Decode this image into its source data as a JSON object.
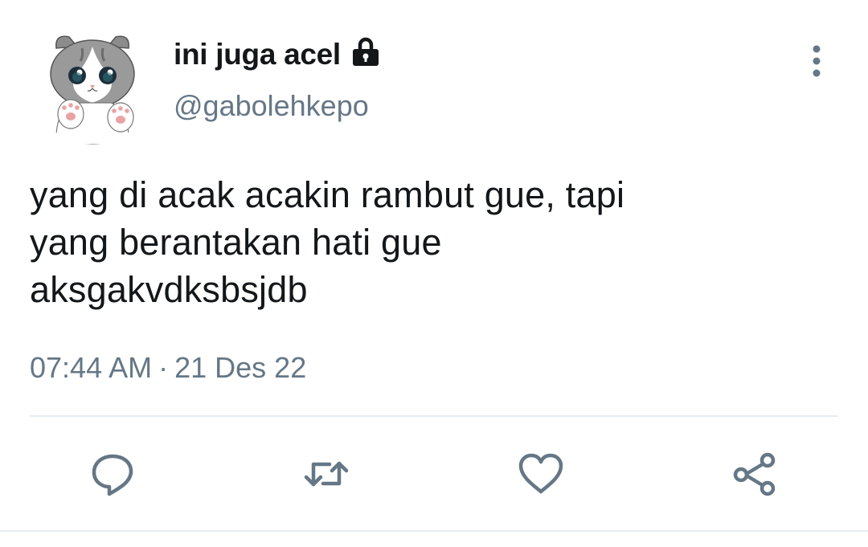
{
  "tweet": {
    "author": {
      "display_name": "ini juga acel",
      "handle": "@gabolehkepo",
      "protected_icon": "lock-icon",
      "avatar": "cat-avatar"
    },
    "text_lines": [
      "yang di acak acakin rambut gue, tapi",
      "yang berantakan hati gue",
      "aksgakvdksbsjdb"
    ],
    "time": "07:44 AM",
    "separator": "·",
    "date": "21 Des 22",
    "more_icon": "more-vertical-icon",
    "actions": [
      {
        "name": "reply",
        "icon": "reply-icon"
      },
      {
        "name": "retweet",
        "icon": "retweet-icon"
      },
      {
        "name": "like",
        "icon": "heart-icon"
      },
      {
        "name": "share",
        "icon": "share-icon"
      }
    ]
  },
  "colors": {
    "text_primary": "#14171a",
    "text_secondary": "#657786",
    "divider": "#e6ecf0",
    "icon": "#657786"
  }
}
